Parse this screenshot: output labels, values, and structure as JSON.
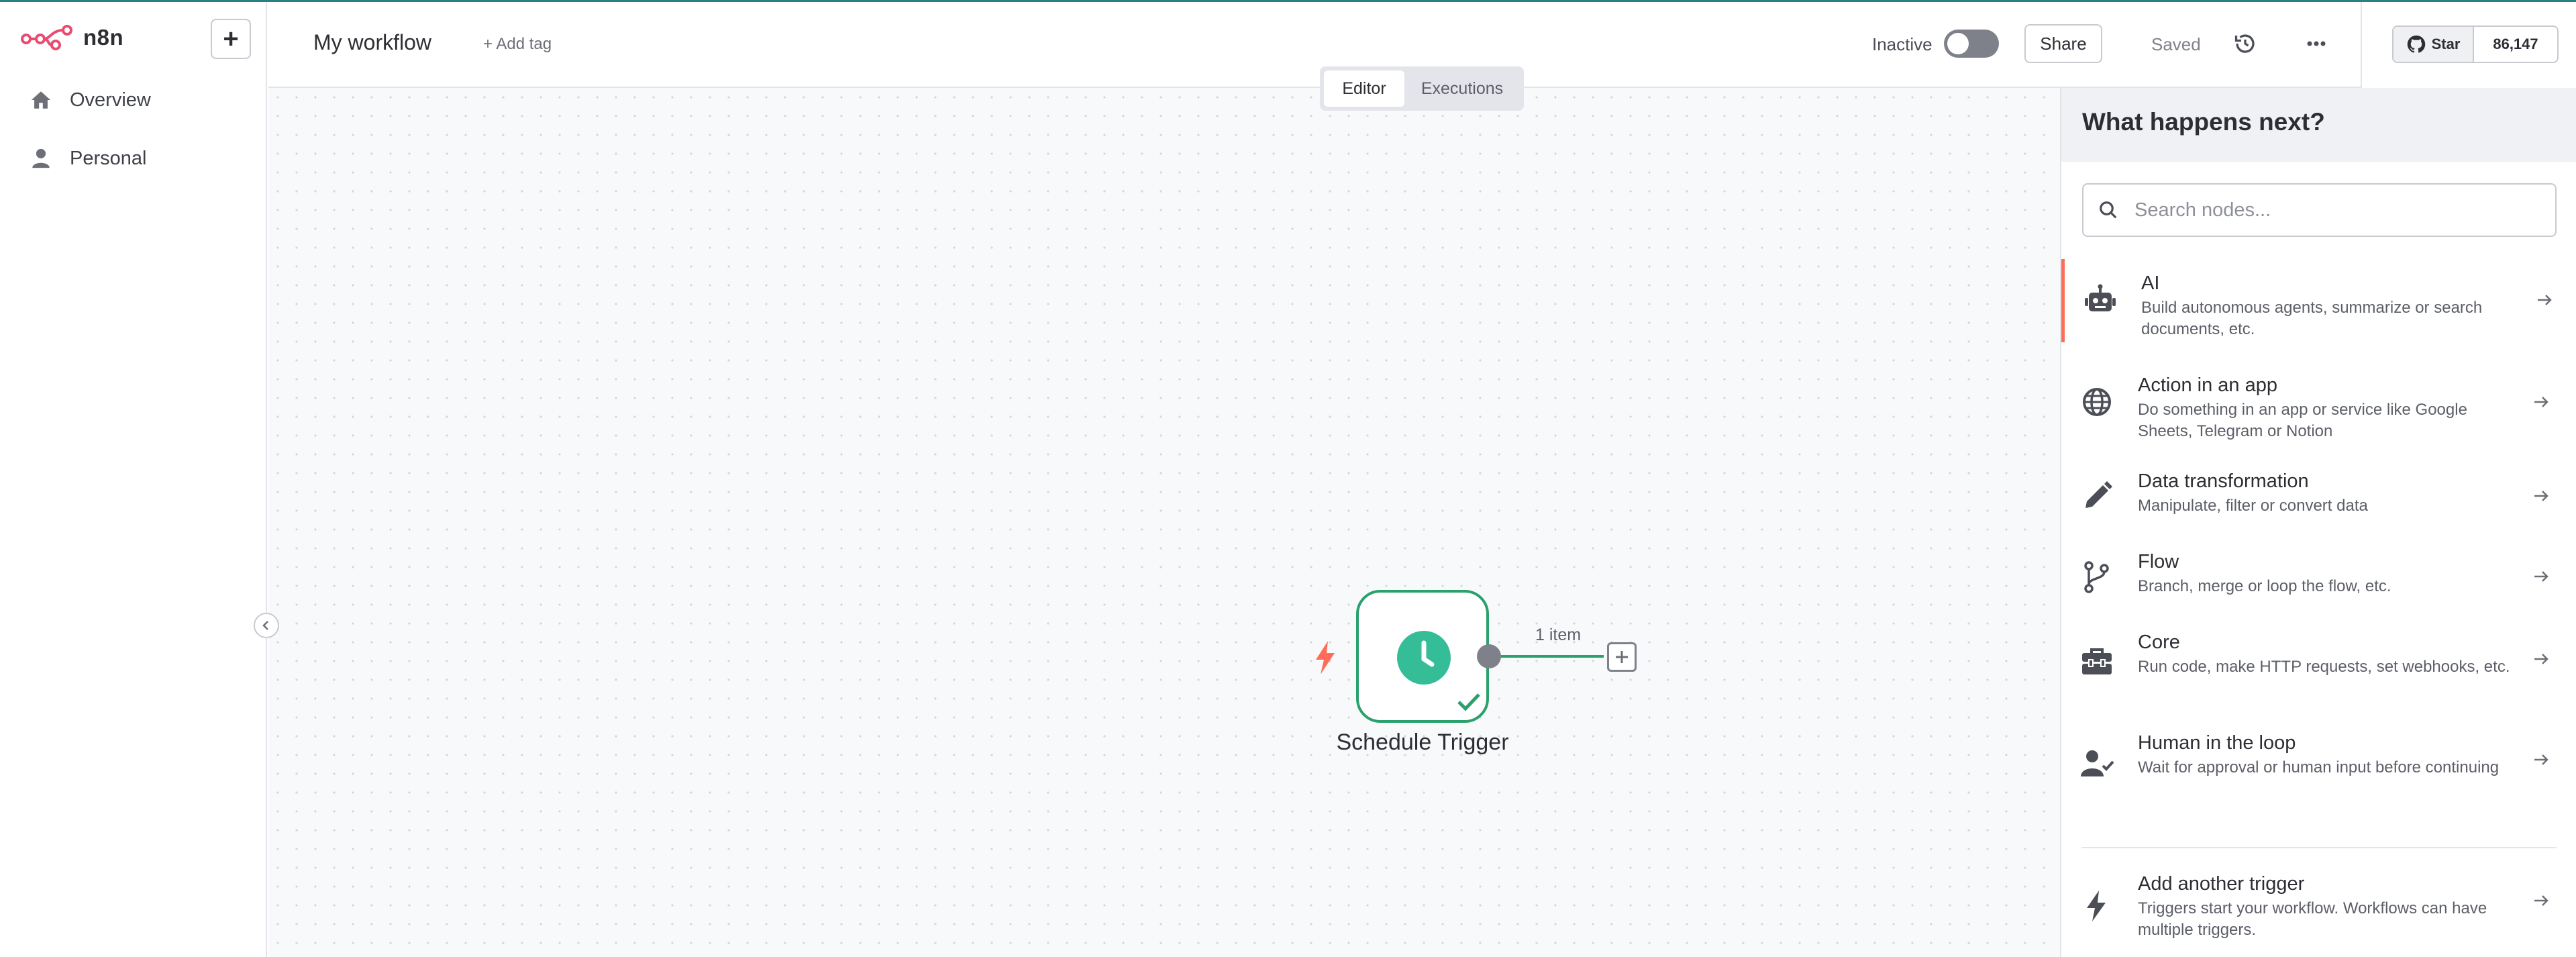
{
  "app": {
    "name": "n8n"
  },
  "sidebar": {
    "items": [
      {
        "label": "Overview",
        "icon": "home-icon"
      },
      {
        "label": "Personal",
        "icon": "user-icon"
      }
    ]
  },
  "header": {
    "workflow_name": "My workflow",
    "add_tag": "+ Add tag",
    "status_label": "Inactive",
    "active": false,
    "share_label": "Share",
    "saved_label": "Saved",
    "github_star_label": "Star",
    "github_star_count": "86,147"
  },
  "canvas": {
    "tabs": [
      {
        "label": "Editor",
        "active": true
      },
      {
        "label": "Executions",
        "active": false
      }
    ],
    "node": {
      "name": "Schedule Trigger",
      "icon": "clock-icon",
      "status": "success"
    },
    "edge_label": "1 item"
  },
  "panel": {
    "title": "What happens next?",
    "search_placeholder": "Search nodes...",
    "items": [
      {
        "title": "AI",
        "desc": "Build autonomous agents, summarize or search documents, etc.",
        "icon": "robot-icon"
      },
      {
        "title": "Action in an app",
        "desc": "Do something in an app or service like Google Sheets, Telegram or Notion",
        "icon": "globe-icon"
      },
      {
        "title": "Data transformation",
        "desc": "Manipulate, filter or convert data",
        "icon": "pencil-icon"
      },
      {
        "title": "Flow",
        "desc": "Branch, merge or loop the flow, etc.",
        "icon": "branch-icon"
      },
      {
        "title": "Core",
        "desc": "Run code, make HTTP requests, set webhooks, etc.",
        "icon": "toolbox-icon"
      },
      {
        "title": "Human in the loop",
        "desc": "Wait for approval or human input before continuing",
        "icon": "user-check-icon"
      }
    ],
    "trigger_item": {
      "title": "Add another trigger",
      "desc": "Triggers start your workflow. Workflows can have multiple triggers.",
      "icon": "bolt-icon"
    }
  },
  "colors": {
    "accent": "#ff6d5a",
    "brand": "#ea4b71",
    "success": "#2aa06b",
    "clock": "#35bd98"
  }
}
